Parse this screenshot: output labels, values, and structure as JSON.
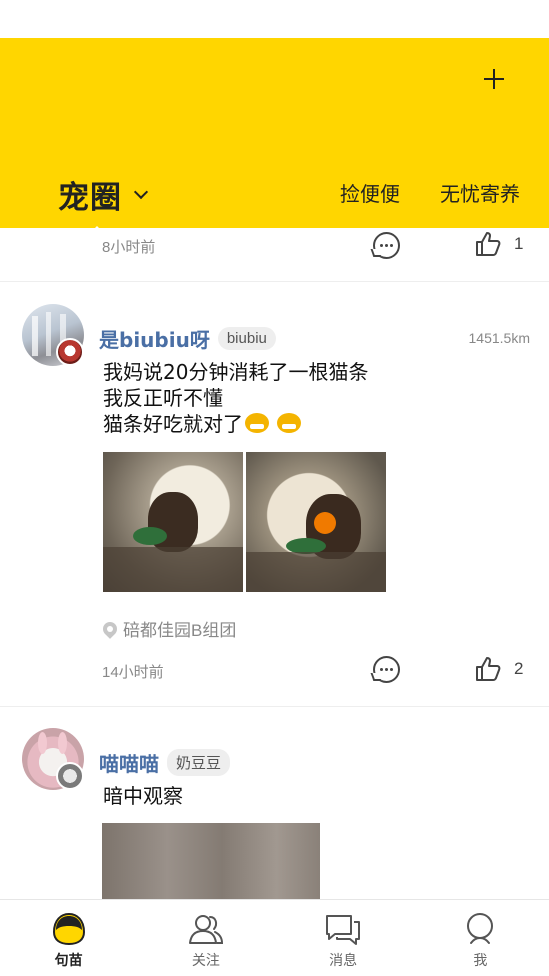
{
  "header": {
    "title": "宠圈",
    "links": [
      "捡便便",
      "无忧寄养"
    ],
    "accent_color": "#FFD600",
    "add_icon": "plus-icon"
  },
  "feed": {
    "top_partial": {
      "time": "8小时前",
      "likes": "1"
    },
    "posts": [
      {
        "username": "是biubiu呀",
        "pet_tag": "biubiu",
        "distance": "1451.5km",
        "lines": [
          "我妈说20分钟消耗了一根猫条",
          "我反正听不懂",
          "猫条好吃就对了"
        ],
        "location": "碚都佳园B组团",
        "time": "14小时前",
        "likes": "2"
      },
      {
        "username": "喵喵喵",
        "pet_tag": "奶豆豆",
        "lines": [
          "暗中观察"
        ]
      }
    ]
  },
  "tabbar": {
    "tabs": [
      {
        "label": "句苗",
        "icon": "cat-face-icon",
        "active": true
      },
      {
        "label": "关注",
        "icon": "follow-icon",
        "active": false
      },
      {
        "label": "消息",
        "icon": "message-icon",
        "active": false
      },
      {
        "label": "我",
        "icon": "profile-icon",
        "active": false
      }
    ]
  }
}
